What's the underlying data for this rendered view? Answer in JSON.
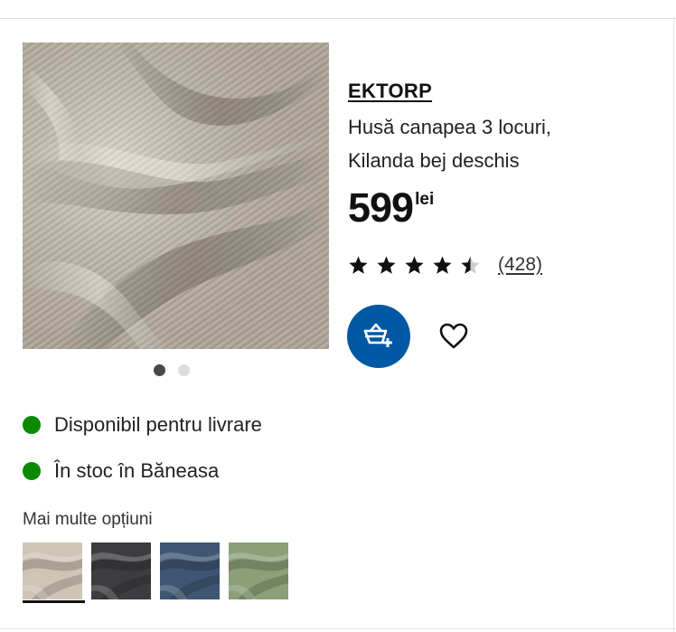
{
  "product": {
    "brand": "EKTORP",
    "description_line1": "Husă canapea 3 locuri,",
    "description_line2": "Kilanda bej deschis",
    "price_amount": "599",
    "price_currency": "lei",
    "rating_value": 4.5,
    "rating_max": 5,
    "review_count": "(428)",
    "image_icon": "fabric-photo",
    "image_count": 2,
    "active_image_index": 0
  },
  "actions": {
    "cart_icon": "add-to-cart-icon",
    "favourite_icon": "heart-icon"
  },
  "availability": {
    "delivery": "Disponibil pentru livrare",
    "store": "În stoc în Băneasa",
    "status_color": "#0a8a00"
  },
  "options": {
    "heading": "Mai multe opțiuni",
    "selected_index": 0,
    "swatches": [
      {
        "color": "#cfc5b6"
      },
      {
        "color": "#3d3d40"
      },
      {
        "color": "#3e5673"
      },
      {
        "color": "#8b9f78"
      }
    ]
  },
  "colors": {
    "accent_blue": "#0058a3",
    "text": "#111111"
  }
}
